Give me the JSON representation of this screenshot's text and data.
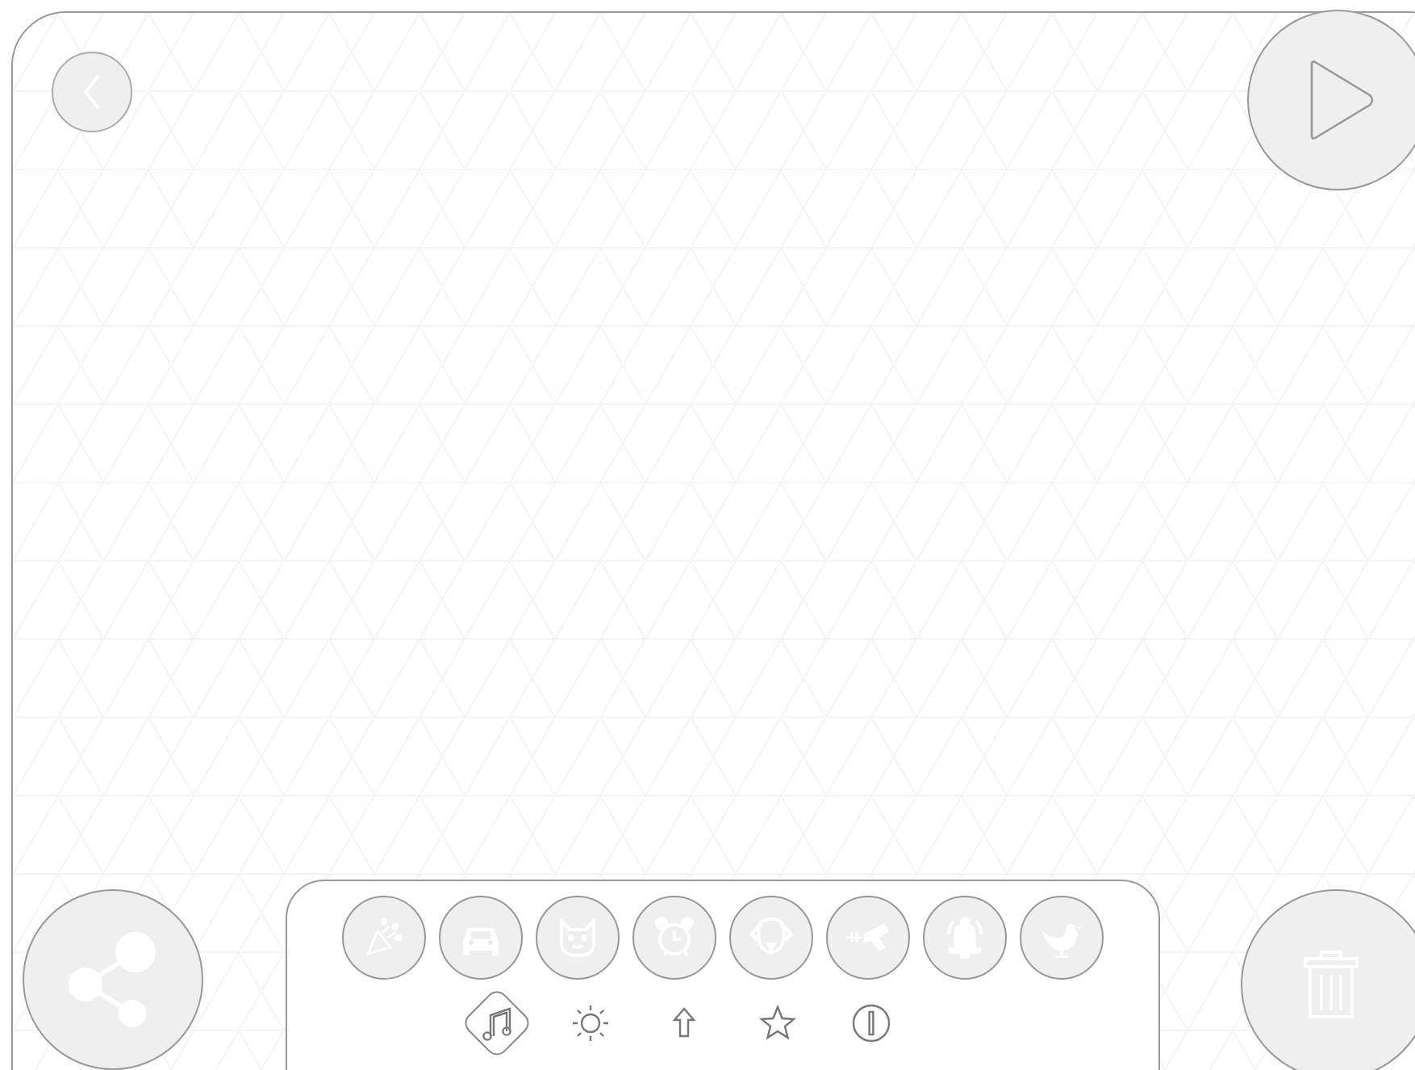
{
  "sounds": [
    {
      "kind": "party"
    },
    {
      "kind": "car"
    },
    {
      "kind": "cat"
    },
    {
      "kind": "alarm"
    },
    {
      "kind": "dog"
    },
    {
      "kind": "laser"
    },
    {
      "kind": "bell"
    },
    {
      "kind": "bird"
    }
  ],
  "categories": [
    {
      "kind": "music",
      "selected": true
    },
    {
      "kind": "light",
      "selected": false
    },
    {
      "kind": "arrow",
      "selected": false
    },
    {
      "kind": "star",
      "selected": false
    },
    {
      "kind": "alert",
      "selected": false
    }
  ]
}
